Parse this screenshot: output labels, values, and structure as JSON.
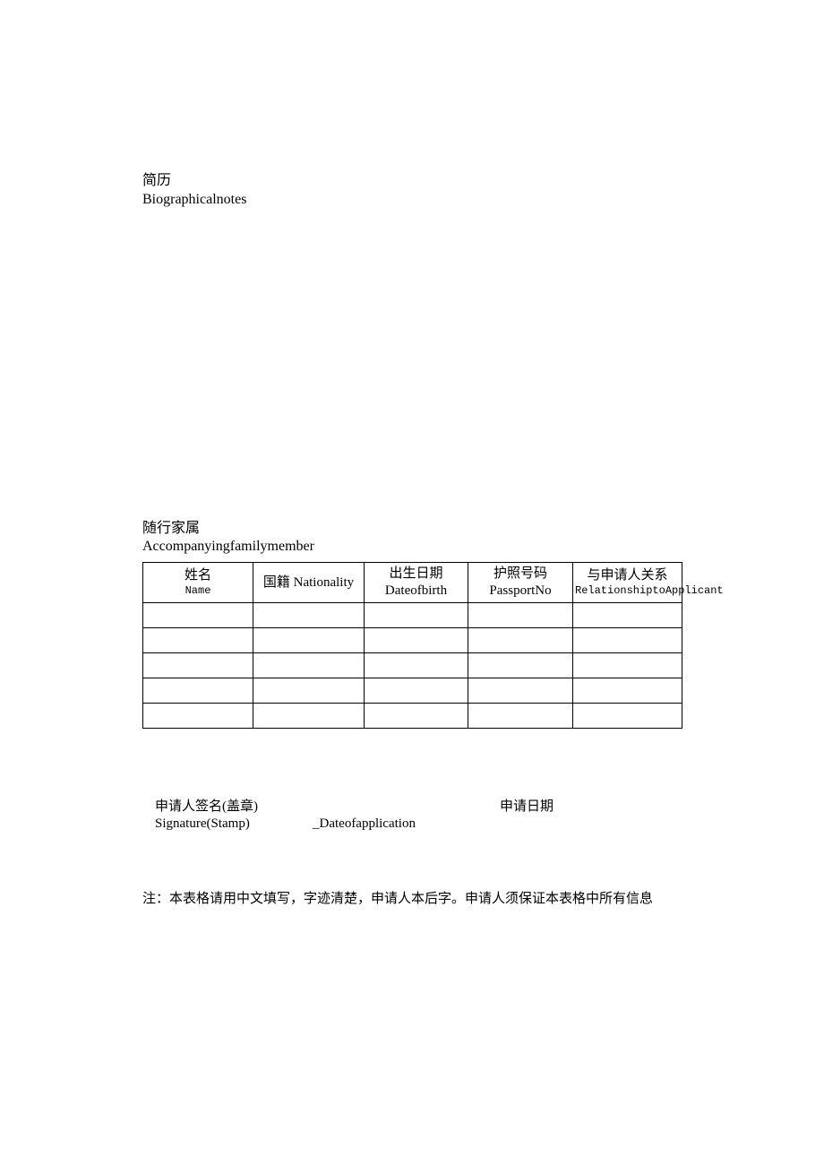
{
  "bio": {
    "title_cn": "简历",
    "title_en": "Biographicalnotes"
  },
  "family": {
    "title_cn": "随行家属",
    "title_en": "Accompanyingfamilymember",
    "headers": {
      "name_cn": "姓名",
      "name_en": "Name",
      "nat": "国籍 Nationality",
      "dob_cn": "出生日期",
      "dob_en": "Dateofbirth",
      "pass_cn": "护照号码",
      "pass_en": "PassportNo",
      "rel_cn": "与申请人关系",
      "rel_en": "RelationshiptoApplicant"
    },
    "rows": [
      {
        "name": "",
        "nat": "",
        "dob": "",
        "pass": "",
        "rel": ""
      },
      {
        "name": "",
        "nat": "",
        "dob": "",
        "pass": "",
        "rel": ""
      },
      {
        "name": "",
        "nat": "",
        "dob": "",
        "pass": "",
        "rel": ""
      },
      {
        "name": "",
        "nat": "",
        "dob": "",
        "pass": "",
        "rel": ""
      },
      {
        "name": "",
        "nat": "",
        "dob": "",
        "pass": "",
        "rel": ""
      }
    ]
  },
  "signature": {
    "label_cn": "申请人签名(盖章)",
    "label_en": "Signature(Stamp)",
    "date_en_prefix": "_Dateofapplication",
    "date_cn": "申请日期"
  },
  "note": "注：本表格请用中文填写，字迹清楚，申请人本后字。申请人须保证本表格中所有信息"
}
